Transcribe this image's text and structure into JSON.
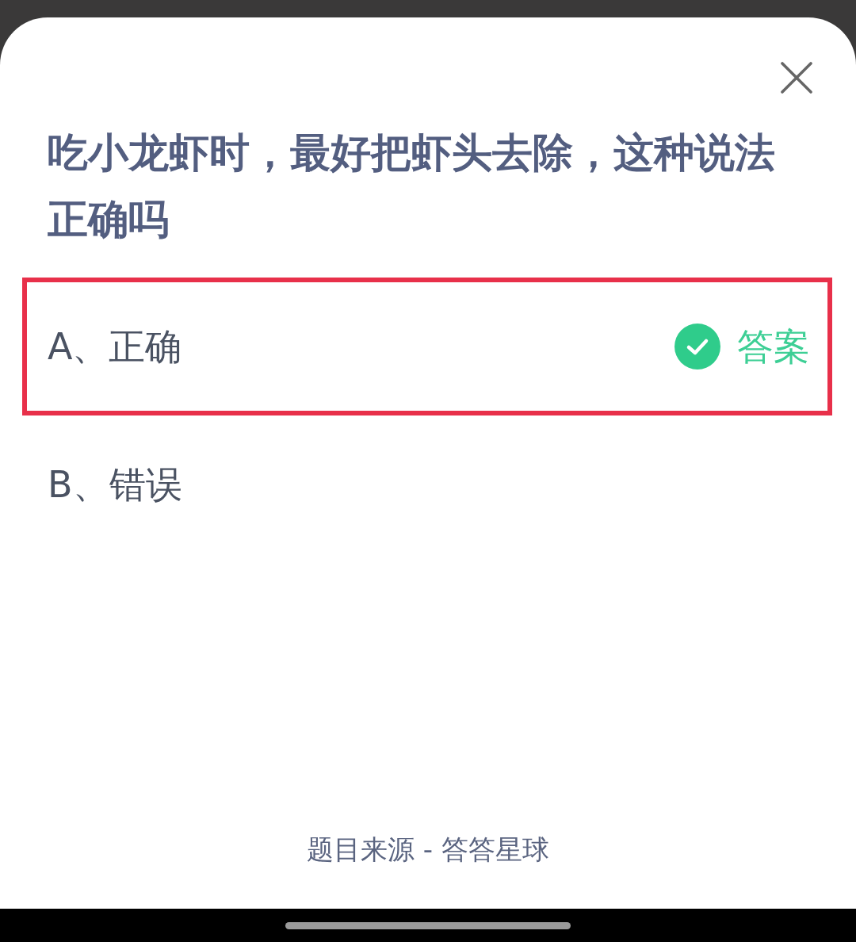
{
  "question": {
    "title": "吃小龙虾时，最好把虾头去除，这种说法正确吗"
  },
  "options": [
    {
      "label": "A、正确",
      "correct": true,
      "answer_tag": "答案",
      "highlighted": true
    },
    {
      "label": "B、错误",
      "correct": false,
      "highlighted": false
    }
  ],
  "footer": {
    "source": "题目来源 - 答答星球"
  }
}
